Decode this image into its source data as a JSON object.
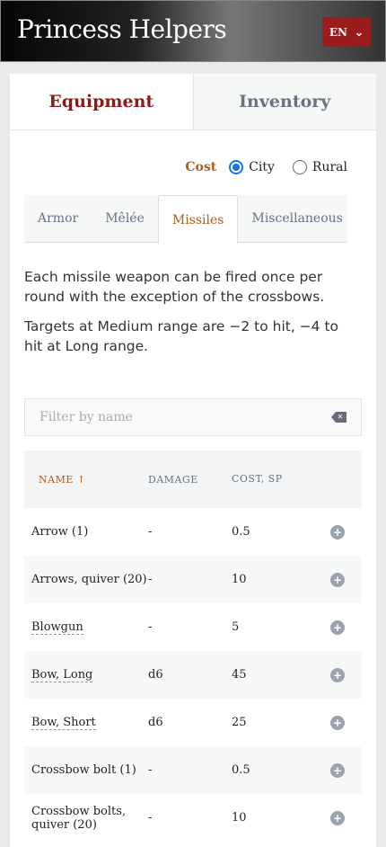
{
  "app": {
    "title": "Princess Helpers",
    "language": "EN"
  },
  "main_tabs": [
    {
      "label": "Equipment",
      "active": true
    },
    {
      "label": "Inventory",
      "active": false
    }
  ],
  "cost": {
    "label": "Cost",
    "options": [
      {
        "label": "City",
        "selected": true
      },
      {
        "label": "Rural",
        "selected": false
      }
    ]
  },
  "sub_tabs": [
    {
      "label": "Armor"
    },
    {
      "label": "Mêlée"
    },
    {
      "label": "Missiles",
      "active": true
    },
    {
      "label": "Miscellaneous"
    }
  ],
  "description": [
    "Each missile weapon can be fired once per round with the exception of the crossbows.",
    "Targets at Medium range are −2 to hit, −4 to hit at Long range."
  ],
  "filter": {
    "placeholder": "Filter by name",
    "value": ""
  },
  "table": {
    "headers": {
      "name": "NAME ↑",
      "damage": "DAMAGE",
      "cost": "COST, SP"
    },
    "rows": [
      {
        "name": "Arrow (1)",
        "damage": "-",
        "cost": "0.5"
      },
      {
        "name": "Arrows, quiver (20)",
        "damage": "-",
        "cost": "10"
      },
      {
        "name": "Blowgun",
        "damage": "-",
        "cost": "5"
      },
      {
        "name": "Bow, Long",
        "damage": "d6",
        "cost": "45"
      },
      {
        "name": "Bow, Short",
        "damage": "d6",
        "cost": "25"
      },
      {
        "name": "Crossbow bolt (1)",
        "damage": "-",
        "cost": "0.5"
      },
      {
        "name": "Crossbow bolts, quiver (20)",
        "damage": "-",
        "cost": "10"
      }
    ]
  }
}
